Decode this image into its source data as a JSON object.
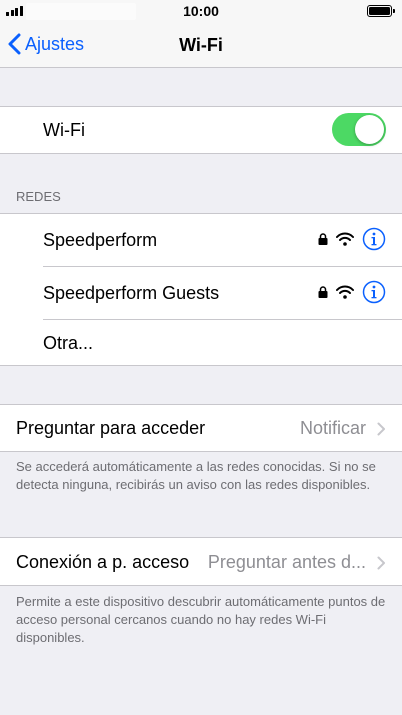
{
  "status_bar": {
    "time": "10:00"
  },
  "nav": {
    "back_label": "Ajustes",
    "title": "Wi-Fi"
  },
  "wifi_toggle": {
    "label": "Wi-Fi",
    "on": true
  },
  "networks": {
    "header": "REDES",
    "items": [
      {
        "name": "Speedperform",
        "secured": true
      },
      {
        "name": "Speedperform Guests",
        "secured": true
      },
      {
        "name": "Otra..."
      }
    ]
  },
  "ask_to_join": {
    "label": "Preguntar para acceder",
    "value": "Notificar",
    "footer": "Se accederá automáticamente a las redes conocidas. Si no se detecta ninguna, recibirás un aviso con las redes disponibles."
  },
  "hotspot": {
    "label": "Conexión a p. acceso",
    "value": "Preguntar antes d...",
    "footer": "Permite a este dispositivo descubrir automáticamente puntos de acceso personal cercanos cuando no hay redes Wi-Fi disponibles."
  },
  "colors": {
    "accent": "#0a60fe",
    "toggle_on": "#4cd964",
    "background": "#efeff4"
  }
}
